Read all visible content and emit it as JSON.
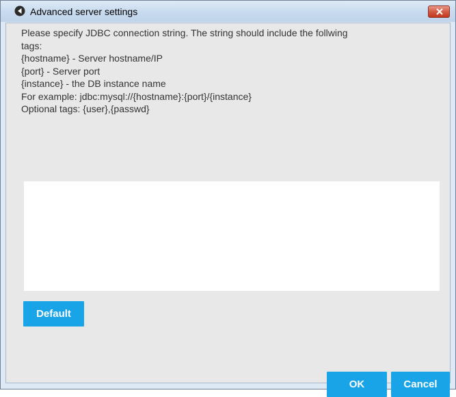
{
  "window": {
    "title": "Advanced server settings",
    "close_label": "close"
  },
  "description": {
    "lines": [
      "Please specify JDBC connection string. The string should include the follwing",
      "tags:",
      "{hostname} - Server hostname/IP",
      "{port} - Server port",
      "{instance} - the DB instance name",
      "For example: jdbc:mysql://{hostname}:{port}/{instance}",
      "Optional tags: {user},{passwd}"
    ]
  },
  "connection_string": {
    "value": "",
    "placeholder": ""
  },
  "buttons": {
    "default_label": "Default",
    "ok_label": "OK",
    "cancel_label": "Cancel"
  },
  "colors": {
    "button_accent": "#19a4e8",
    "client_background": "#e8e8e8",
    "close_button": "#c7432b"
  },
  "icons": {
    "app": "back-arrow-circle-icon",
    "close": "close-icon"
  }
}
